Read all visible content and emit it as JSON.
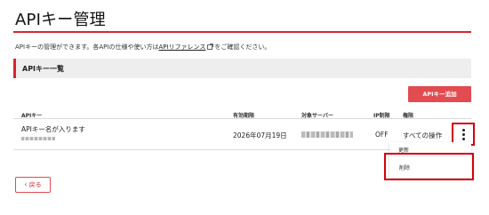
{
  "page": {
    "title": "APIキー管理",
    "intro_before": "APIキーの管理ができます。各APIの仕様や使い方は",
    "intro_link": "APIリファレンス",
    "intro_after": "をご確認ください。"
  },
  "section": {
    "title": "APIキー一覧"
  },
  "add_button_label": "APIキー追加",
  "table": {
    "headers": {
      "key": "APIキー",
      "expiry": "有効期限",
      "server": "対象サーバー",
      "ip": "IP制限",
      "perm": "権限"
    },
    "rows": [
      {
        "key_name": "APIキー名が入ります",
        "expiry": "2026年07月19日",
        "ip_restriction": "OFF",
        "permission": "すべての操作"
      }
    ]
  },
  "row_menu": {
    "update_label": "更新",
    "delete_label": "削除"
  },
  "back_button_label": "戻る",
  "colors": {
    "accent": "#d6262c",
    "button": "#e24b4f",
    "highlight": "#d4000b"
  },
  "icons": {
    "external_link": "external-link-icon",
    "kebab": "more-vertical-icon",
    "back": "chevron-left-icon"
  }
}
